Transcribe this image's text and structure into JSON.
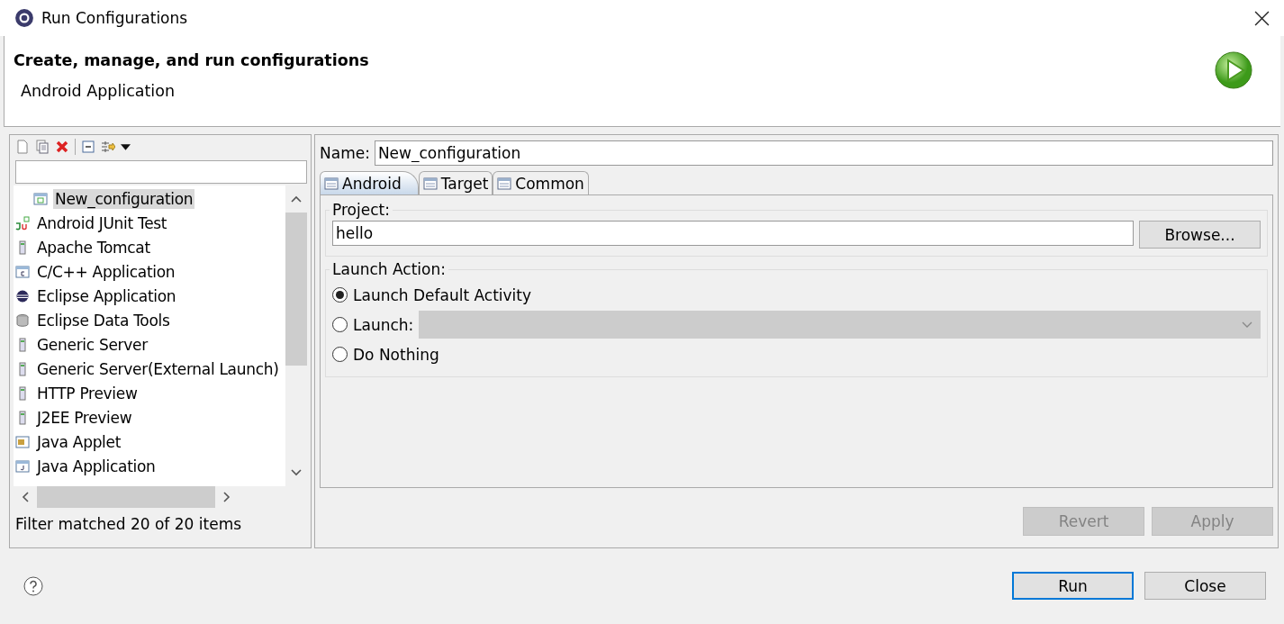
{
  "window": {
    "title": "Run Configurations"
  },
  "header": {
    "title": "Create, manage, and run configurations",
    "subtitle": "Android Application"
  },
  "tree": {
    "items": [
      {
        "label": "New_configuration",
        "kind": "config",
        "selected": true
      },
      {
        "label": "Android JUnit Test",
        "kind": "junit",
        "selected": false
      },
      {
        "label": "Apache Tomcat",
        "kind": "server",
        "selected": false
      },
      {
        "label": "C/C++ Application",
        "kind": "capp",
        "selected": false
      },
      {
        "label": "Eclipse Application",
        "kind": "eclipse",
        "selected": false
      },
      {
        "label": "Eclipse Data Tools",
        "kind": "database",
        "selected": false
      },
      {
        "label": "Generic Server",
        "kind": "server",
        "selected": false
      },
      {
        "label": "Generic Server(External Launch)",
        "kind": "server",
        "selected": false
      },
      {
        "label": "HTTP Preview",
        "kind": "server",
        "selected": false
      },
      {
        "label": "J2EE Preview",
        "kind": "server",
        "selected": false
      },
      {
        "label": "Java Applet",
        "kind": "applet",
        "selected": false
      },
      {
        "label": "Java Application",
        "kind": "japp",
        "selected": false
      }
    ],
    "status": "Filter matched 20 of 20 items"
  },
  "name": {
    "label": "Name:",
    "value": "New_configuration"
  },
  "tabs": [
    {
      "label": "Android",
      "selected": true
    },
    {
      "label": "Target",
      "selected": false
    },
    {
      "label": "Common",
      "selected": false
    }
  ],
  "project": {
    "legend": "Project:",
    "value": "hello",
    "button": "Browse..."
  },
  "launch": {
    "legend": "Launch Action:",
    "options": [
      {
        "label": "Launch Default Activity",
        "selected": true
      },
      {
        "label": "Launch:",
        "selected": false,
        "kind": "dropdown",
        "disabled": true
      },
      {
        "label": "Do Nothing",
        "selected": false
      }
    ]
  },
  "actions": [
    {
      "label": "Revert",
      "disabled": true
    },
    {
      "label": "Apply",
      "disabled": true
    }
  ],
  "footer": [
    {
      "label": "Run",
      "default": true
    },
    {
      "label": "Close",
      "default": false
    }
  ]
}
